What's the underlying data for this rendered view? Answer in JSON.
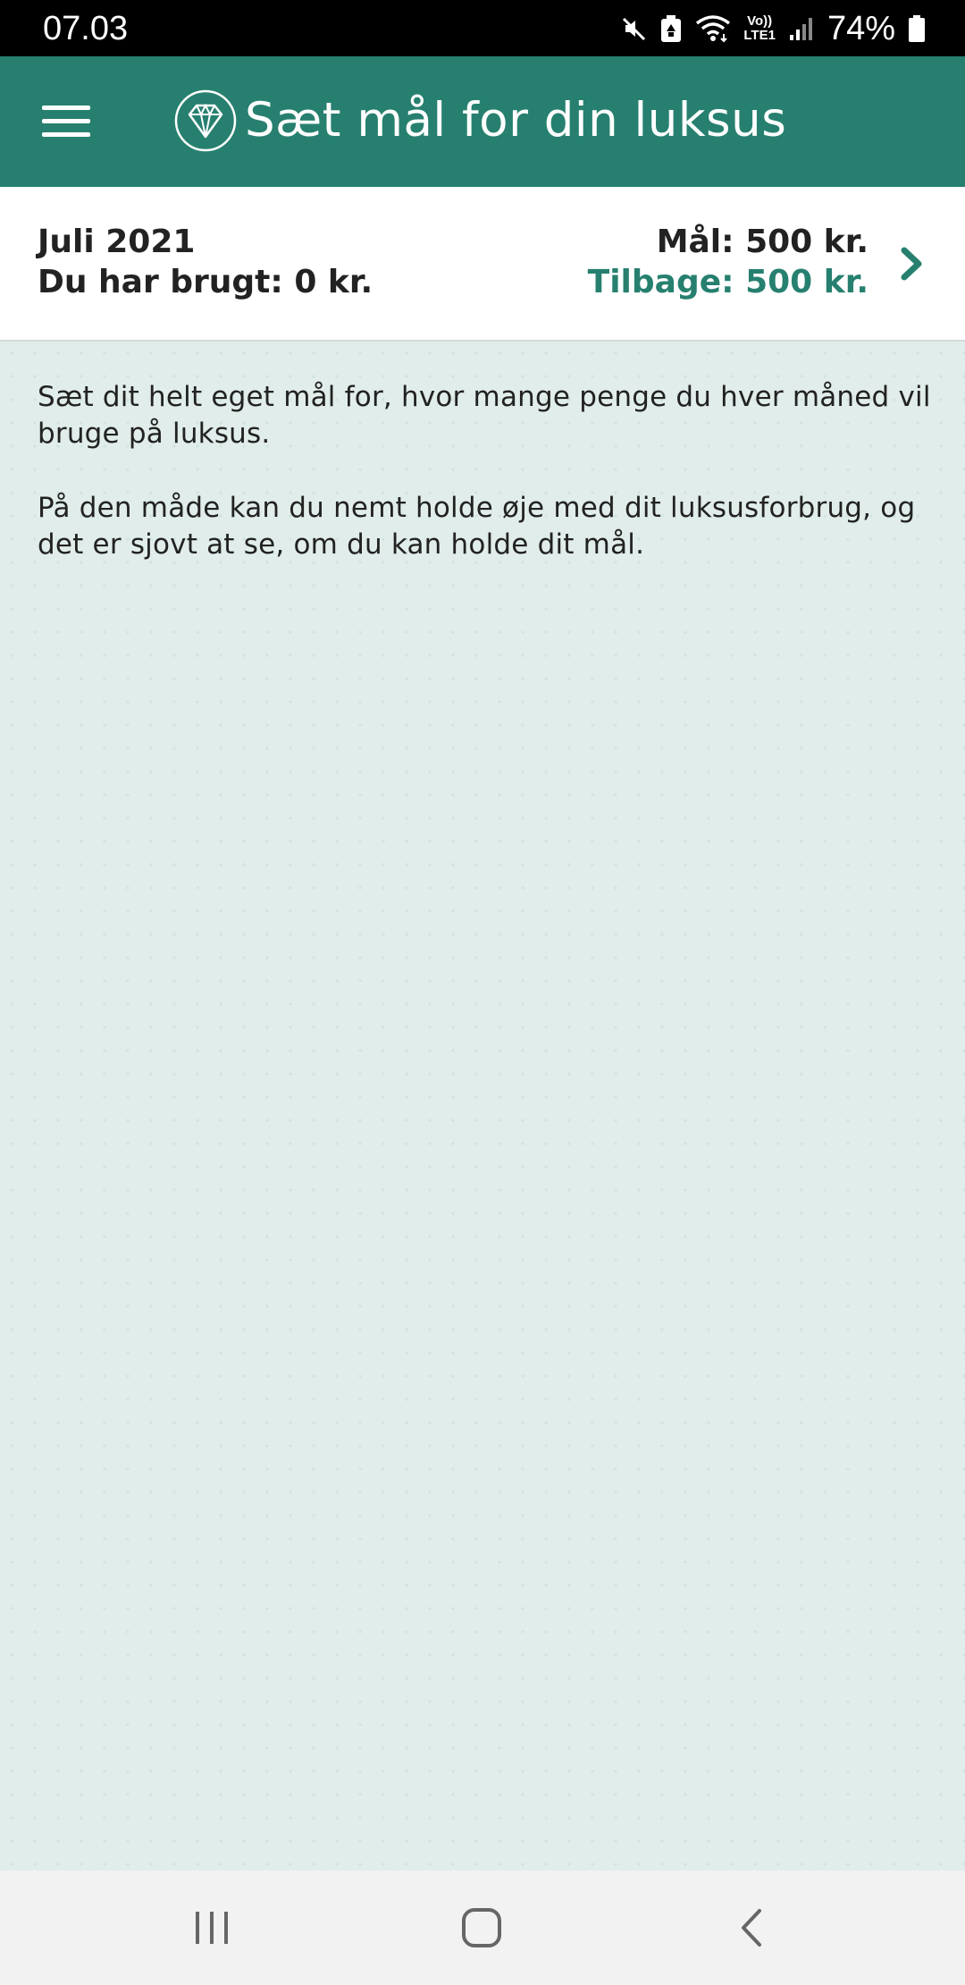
{
  "status_bar": {
    "time": "07.03",
    "network_label_top": "Vo))",
    "network_label_bottom": "LTE1",
    "battery_percent": "74%",
    "icons": [
      "mute-icon",
      "battery-saver-icon",
      "wifi-icon",
      "volte-lte-icon",
      "signal-icon",
      "battery-icon"
    ]
  },
  "app_bar": {
    "title": "Sæt mål for din luksus",
    "menu_icon": "hamburger-menu-icon",
    "logo_icon": "diamond-icon"
  },
  "summary": {
    "month": "Juli 2021",
    "spent": "Du har brugt: 0 kr.",
    "goal": "Mål: 500 kr.",
    "remaining": "Tilbage: 500 kr.",
    "chevron_icon": "chevron-right-icon"
  },
  "content": {
    "paragraph_1": "Sæt dit helt eget mål for, hvor mange penge du hver måned vil bruge på luksus.",
    "paragraph_2": "På den måde kan du nemt holde øje med dit luksusforbrug, og det er sjovt at se, om du kan holde dit mål."
  },
  "nav_bar": {
    "icons": [
      "recent-apps-icon",
      "home-icon",
      "back-icon"
    ]
  },
  "colors": {
    "brand_green": "#27806f",
    "background": "#e0edea",
    "status_bar": "#000000",
    "text_dark": "#222222"
  }
}
